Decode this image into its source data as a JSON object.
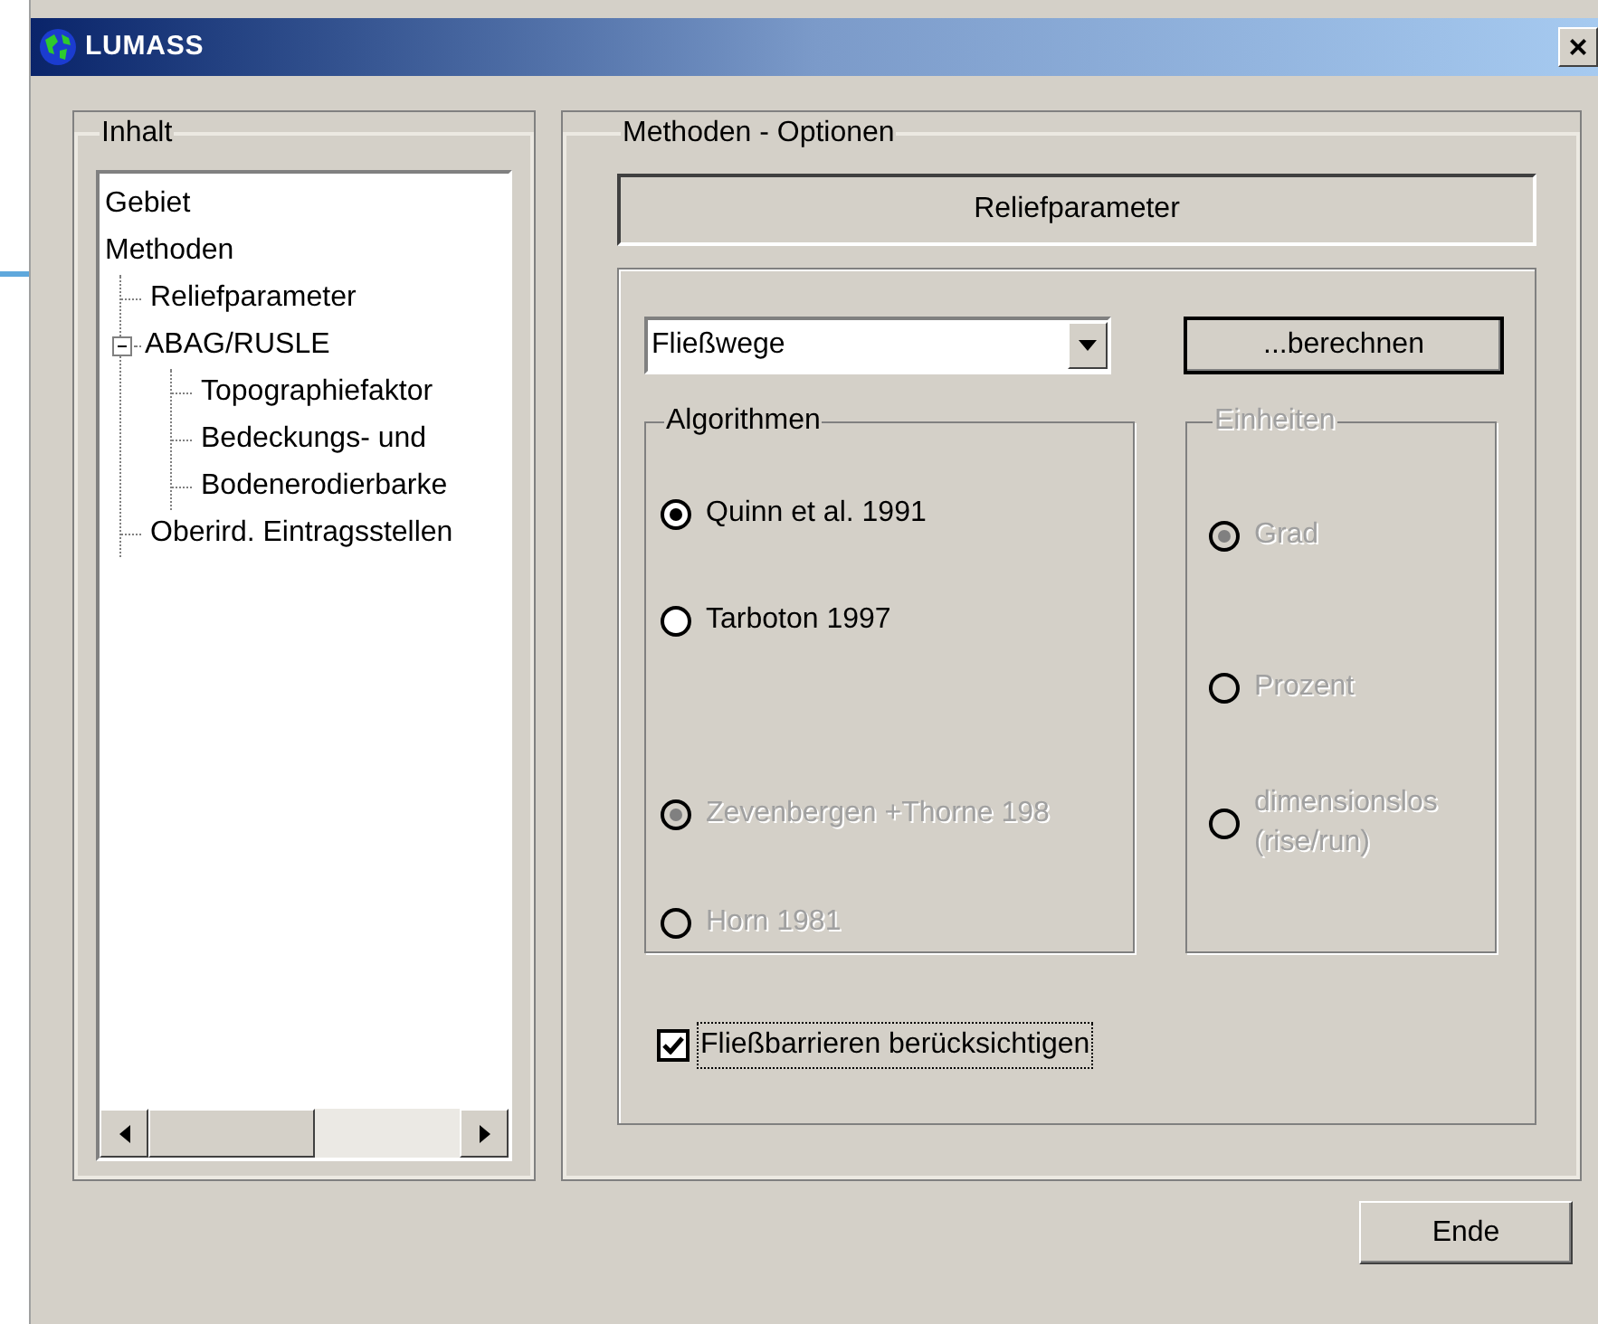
{
  "window": {
    "title": "LUMASS",
    "close": "×"
  },
  "contents": {
    "title": "Inhalt",
    "tree": [
      {
        "label": "Gebiet"
      },
      {
        "label": "Methoden",
        "children": [
          {
            "label": "Reliefparameter"
          },
          {
            "label": "ABAG/RUSLE",
            "expanded": true,
            "children": [
              {
                "label": "Topographiefaktor"
              },
              {
                "label": "Bedeckungs- und"
              },
              {
                "label": "Bodenerodierbarke"
              }
            ]
          },
          {
            "label": "Oberird. Eintragsstellen"
          }
        ]
      }
    ]
  },
  "options": {
    "title": "Methoden - Optionen",
    "heading": "Reliefparameter",
    "dropdown": {
      "value": "Fließwege"
    },
    "compute_button": "...berechnen",
    "algorithms": {
      "title": "Algorithmen",
      "disabled": false,
      "items": [
        {
          "label": "Quinn et al. 1991",
          "selected": true,
          "disabled": false
        },
        {
          "label": "Tarboton 1997",
          "selected": false,
          "disabled": false
        },
        {
          "label": "Zevenbergen +Thorne 198",
          "selected": true,
          "disabled": true
        },
        {
          "label": "Horn 1981",
          "selected": false,
          "disabled": true
        }
      ]
    },
    "units": {
      "title": "Einheiten",
      "disabled": true,
      "items": [
        {
          "label": "Grad",
          "selected": true,
          "disabled": true
        },
        {
          "label": "Prozent",
          "selected": false,
          "disabled": true
        },
        {
          "label": "dimensionslos (rise/run)",
          "selected": false,
          "disabled": true
        }
      ]
    },
    "flow_barriers": {
      "label": "Fließbarrieren berücksichtigen",
      "checked": true
    }
  },
  "end_button": "Ende"
}
